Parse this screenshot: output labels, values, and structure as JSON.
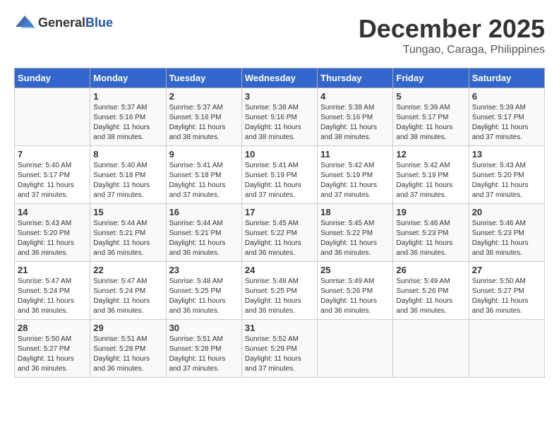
{
  "header": {
    "logo_general": "General",
    "logo_blue": "Blue",
    "month": "December 2025",
    "location": "Tungao, Caraga, Philippines"
  },
  "days_of_week": [
    "Sunday",
    "Monday",
    "Tuesday",
    "Wednesday",
    "Thursday",
    "Friday",
    "Saturday"
  ],
  "weeks": [
    [
      {
        "day": "",
        "empty": true
      },
      {
        "day": "1",
        "sunrise": "Sunrise: 5:37 AM",
        "sunset": "Sunset: 5:16 PM",
        "daylight": "Daylight: 11 hours and 38 minutes."
      },
      {
        "day": "2",
        "sunrise": "Sunrise: 5:37 AM",
        "sunset": "Sunset: 5:16 PM",
        "daylight": "Daylight: 11 hours and 38 minutes."
      },
      {
        "day": "3",
        "sunrise": "Sunrise: 5:38 AM",
        "sunset": "Sunset: 5:16 PM",
        "daylight": "Daylight: 11 hours and 38 minutes."
      },
      {
        "day": "4",
        "sunrise": "Sunrise: 5:38 AM",
        "sunset": "Sunset: 5:16 PM",
        "daylight": "Daylight: 11 hours and 38 minutes."
      },
      {
        "day": "5",
        "sunrise": "Sunrise: 5:39 AM",
        "sunset": "Sunset: 5:17 PM",
        "daylight": "Daylight: 11 hours and 38 minutes."
      },
      {
        "day": "6",
        "sunrise": "Sunrise: 5:39 AM",
        "sunset": "Sunset: 5:17 PM",
        "daylight": "Daylight: 11 hours and 37 minutes."
      }
    ],
    [
      {
        "day": "7",
        "sunrise": "Sunrise: 5:40 AM",
        "sunset": "Sunset: 5:17 PM",
        "daylight": "Daylight: 11 hours and 37 minutes."
      },
      {
        "day": "8",
        "sunrise": "Sunrise: 5:40 AM",
        "sunset": "Sunset: 5:18 PM",
        "daylight": "Daylight: 11 hours and 37 minutes."
      },
      {
        "day": "9",
        "sunrise": "Sunrise: 5:41 AM",
        "sunset": "Sunset: 5:18 PM",
        "daylight": "Daylight: 11 hours and 37 minutes."
      },
      {
        "day": "10",
        "sunrise": "Sunrise: 5:41 AM",
        "sunset": "Sunset: 5:19 PM",
        "daylight": "Daylight: 11 hours and 37 minutes."
      },
      {
        "day": "11",
        "sunrise": "Sunrise: 5:42 AM",
        "sunset": "Sunset: 5:19 PM",
        "daylight": "Daylight: 11 hours and 37 minutes."
      },
      {
        "day": "12",
        "sunrise": "Sunrise: 5:42 AM",
        "sunset": "Sunset: 5:19 PM",
        "daylight": "Daylight: 11 hours and 37 minutes."
      },
      {
        "day": "13",
        "sunrise": "Sunrise: 5:43 AM",
        "sunset": "Sunset: 5:20 PM",
        "daylight": "Daylight: 11 hours and 37 minutes."
      }
    ],
    [
      {
        "day": "14",
        "sunrise": "Sunrise: 5:43 AM",
        "sunset": "Sunset: 5:20 PM",
        "daylight": "Daylight: 11 hours and 36 minutes."
      },
      {
        "day": "15",
        "sunrise": "Sunrise: 5:44 AM",
        "sunset": "Sunset: 5:21 PM",
        "daylight": "Daylight: 11 hours and 36 minutes."
      },
      {
        "day": "16",
        "sunrise": "Sunrise: 5:44 AM",
        "sunset": "Sunset: 5:21 PM",
        "daylight": "Daylight: 11 hours and 36 minutes."
      },
      {
        "day": "17",
        "sunrise": "Sunrise: 5:45 AM",
        "sunset": "Sunset: 5:22 PM",
        "daylight": "Daylight: 11 hours and 36 minutes."
      },
      {
        "day": "18",
        "sunrise": "Sunrise: 5:45 AM",
        "sunset": "Sunset: 5:22 PM",
        "daylight": "Daylight: 11 hours and 36 minutes."
      },
      {
        "day": "19",
        "sunrise": "Sunrise: 5:46 AM",
        "sunset": "Sunset: 5:23 PM",
        "daylight": "Daylight: 11 hours and 36 minutes."
      },
      {
        "day": "20",
        "sunrise": "Sunrise: 5:46 AM",
        "sunset": "Sunset: 5:23 PM",
        "daylight": "Daylight: 11 hours and 36 minutes."
      }
    ],
    [
      {
        "day": "21",
        "sunrise": "Sunrise: 5:47 AM",
        "sunset": "Sunset: 5:24 PM",
        "daylight": "Daylight: 11 hours and 36 minutes."
      },
      {
        "day": "22",
        "sunrise": "Sunrise: 5:47 AM",
        "sunset": "Sunset: 5:24 PM",
        "daylight": "Daylight: 11 hours and 36 minutes."
      },
      {
        "day": "23",
        "sunrise": "Sunrise: 5:48 AM",
        "sunset": "Sunset: 5:25 PM",
        "daylight": "Daylight: 11 hours and 36 minutes."
      },
      {
        "day": "24",
        "sunrise": "Sunrise: 5:48 AM",
        "sunset": "Sunset: 5:25 PM",
        "daylight": "Daylight: 11 hours and 36 minutes."
      },
      {
        "day": "25",
        "sunrise": "Sunrise: 5:49 AM",
        "sunset": "Sunset: 5:26 PM",
        "daylight": "Daylight: 11 hours and 36 minutes."
      },
      {
        "day": "26",
        "sunrise": "Sunrise: 5:49 AM",
        "sunset": "Sunset: 5:26 PM",
        "daylight": "Daylight: 11 hours and 36 minutes."
      },
      {
        "day": "27",
        "sunrise": "Sunrise: 5:50 AM",
        "sunset": "Sunset: 5:27 PM",
        "daylight": "Daylight: 11 hours and 36 minutes."
      }
    ],
    [
      {
        "day": "28",
        "sunrise": "Sunrise: 5:50 AM",
        "sunset": "Sunset: 5:27 PM",
        "daylight": "Daylight: 11 hours and 36 minutes."
      },
      {
        "day": "29",
        "sunrise": "Sunrise: 5:51 AM",
        "sunset": "Sunset: 5:28 PM",
        "daylight": "Daylight: 11 hours and 36 minutes."
      },
      {
        "day": "30",
        "sunrise": "Sunrise: 5:51 AM",
        "sunset": "Sunset: 5:28 PM",
        "daylight": "Daylight: 11 hours and 37 minutes."
      },
      {
        "day": "31",
        "sunrise": "Sunrise: 5:52 AM",
        "sunset": "Sunset: 5:29 PM",
        "daylight": "Daylight: 11 hours and 37 minutes."
      },
      {
        "day": "",
        "empty": true
      },
      {
        "day": "",
        "empty": true
      },
      {
        "day": "",
        "empty": true
      }
    ]
  ]
}
